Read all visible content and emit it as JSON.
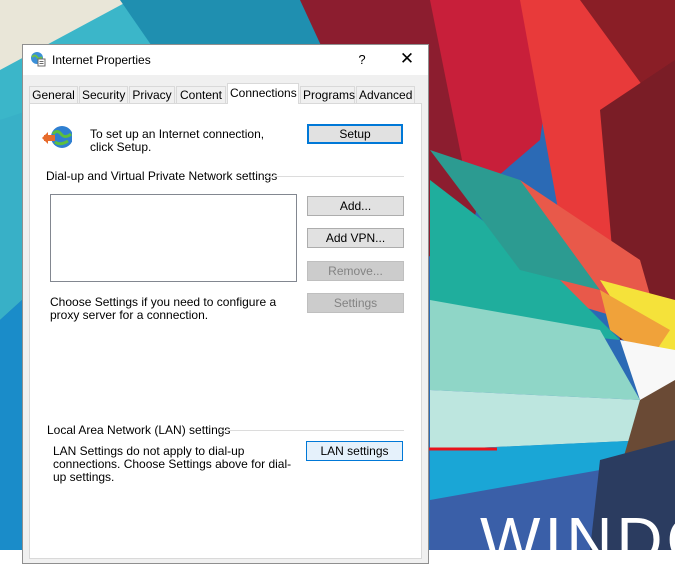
{
  "dialog": {
    "title": "Internet Properties",
    "help_label": "?",
    "close_label": "✕",
    "title_icon": "internet-options-icon"
  },
  "tabs": [
    {
      "label": "General"
    },
    {
      "label": "Security"
    },
    {
      "label": "Privacy"
    },
    {
      "label": "Content"
    },
    {
      "label": "Connections",
      "active": true
    },
    {
      "label": "Programs"
    },
    {
      "label": "Advanced"
    }
  ],
  "connections": {
    "setup_text": "To set up an Internet connection, click Setup.",
    "setup_button": "Setup",
    "dialup_group": "Dial-up and Virtual Private Network settings",
    "add_button": "Add...",
    "add_vpn_button": "Add VPN...",
    "remove_button": "Remove...",
    "settings_text": "Choose Settings if you need to configure a proxy server for a connection.",
    "settings_button": "Settings",
    "lan_group": "Local Area Network (LAN) settings",
    "lan_text": "LAN Settings do not apply to dial-up connections. Choose Settings above for dial-up settings.",
    "lan_button": "LAN settings"
  },
  "desktop": {
    "watermark": "WINDO"
  },
  "colors": {
    "accent": "#0078d7",
    "arrow": "#e8141c"
  }
}
